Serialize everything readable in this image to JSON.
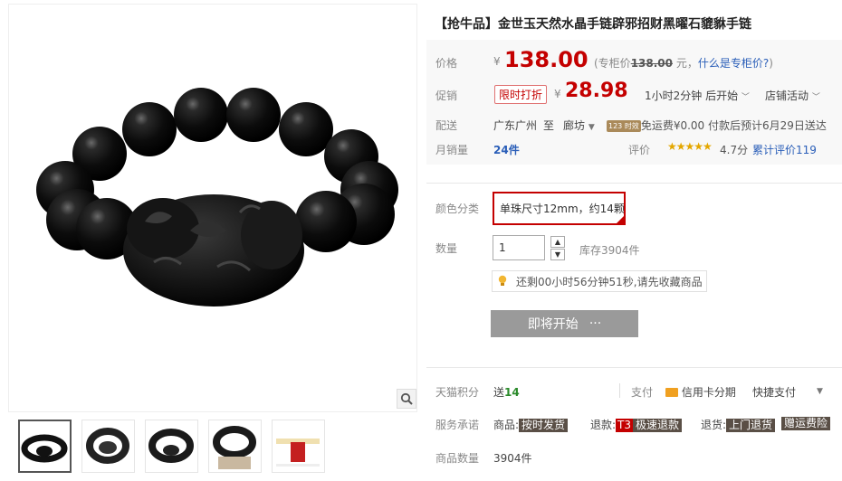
{
  "product": {
    "title": "【抢牛品】金世玉天然水晶手链辟邪招财黑曜石貔貅手链"
  },
  "price": {
    "label": "价格",
    "currency": "¥",
    "value": "138.00",
    "note_prefix": "(专柜价",
    "note_value": "138.00",
    "note_suffix": "元，",
    "note_link": "什么是专柜价?",
    "note_close": ")"
  },
  "promo": {
    "label": "促销",
    "badge": "限时打折",
    "currency": "¥",
    "value": "28.98",
    "countdown": "1小时2分钟 后开始",
    "shop_activity": "店铺活动"
  },
  "shipping": {
    "label": "配送",
    "from": "广东广州",
    "to_word": "至",
    "to": "廊坊",
    "badge": "123 时效",
    "free_label": "免运费",
    "fee": "¥0.00",
    "eta": "付款后预计6月29日送达"
  },
  "sales": {
    "label": "月销量",
    "count": "24件",
    "rating_label": "评价",
    "stars": "★★★★★",
    "score": "4.7分",
    "reviews_label": "累计评价",
    "reviews_count": "119"
  },
  "options": {
    "color_label": "颜色分类",
    "color_value": "单珠尺寸12mm，约14颗",
    "qty_label": "数量",
    "qty_value": "1",
    "stock": "库存3904件",
    "tip": "还剩00小时56分钟51秒,请先收藏商品",
    "start_button": "即将开始",
    "start_dots": "···"
  },
  "services": {
    "points_label": "天猫积分",
    "points_prefix": "送",
    "points_value": "14",
    "pay_label": "支付",
    "pay_credit": "信用卡分期",
    "pay_quick": "快捷支付",
    "promise_label": "服务承诺",
    "item1_prefix": "商品:",
    "item1_tag": "按时发货",
    "item2_prefix": "退款:",
    "item2_tag_red": "T3",
    "item2_tag": "极速退款",
    "item3_prefix": "退货:",
    "item3_tag": "上门退货",
    "item4_tag": "赠运费险",
    "qty_label": "商品数量",
    "qty_value": "3904件"
  },
  "colors": {
    "price_red": "#c40000",
    "link_blue": "#2a5eb8",
    "star_gold": "#e4a700",
    "button_gray": "#9a9a9a"
  }
}
